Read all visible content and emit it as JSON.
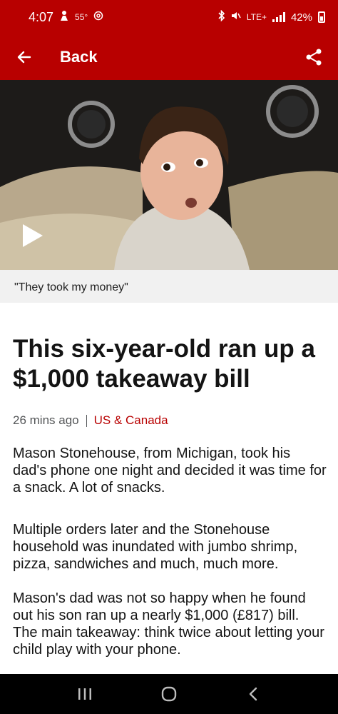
{
  "status_bar": {
    "time": "4:07",
    "temperature": "55°",
    "battery_percent": "42%",
    "network": "LTE+"
  },
  "app_bar": {
    "back_label": "Back"
  },
  "video": {
    "caption": "\"They took my money\""
  },
  "article": {
    "headline": "This six-year-old ran up a $1,000 takeaway bill",
    "timestamp": "26 mins ago",
    "section": "US & Canada",
    "paragraphs": [
      "Mason Stonehouse, from Michigan, took his dad's phone one night and decided it was time for a snack. A lot of snacks.",
      "Multiple orders later and the Stonehouse household was inundated with jumbo shrimp, pizza, sandwiches and much, much more.",
      "Mason's dad was not so happy when he found out his son ran up a nearly $1,000 (£817) bill. The main takeaway: think twice about letting your child play with your phone."
    ]
  },
  "colors": {
    "brand": "#b80000",
    "text": "#141414",
    "meta": "#545658"
  },
  "icons": {
    "back": "arrow-left-icon",
    "share": "share-icon",
    "play": "play-icon",
    "recents": "recents-icon",
    "home": "home-icon",
    "back_nav": "chevron-left-icon"
  }
}
